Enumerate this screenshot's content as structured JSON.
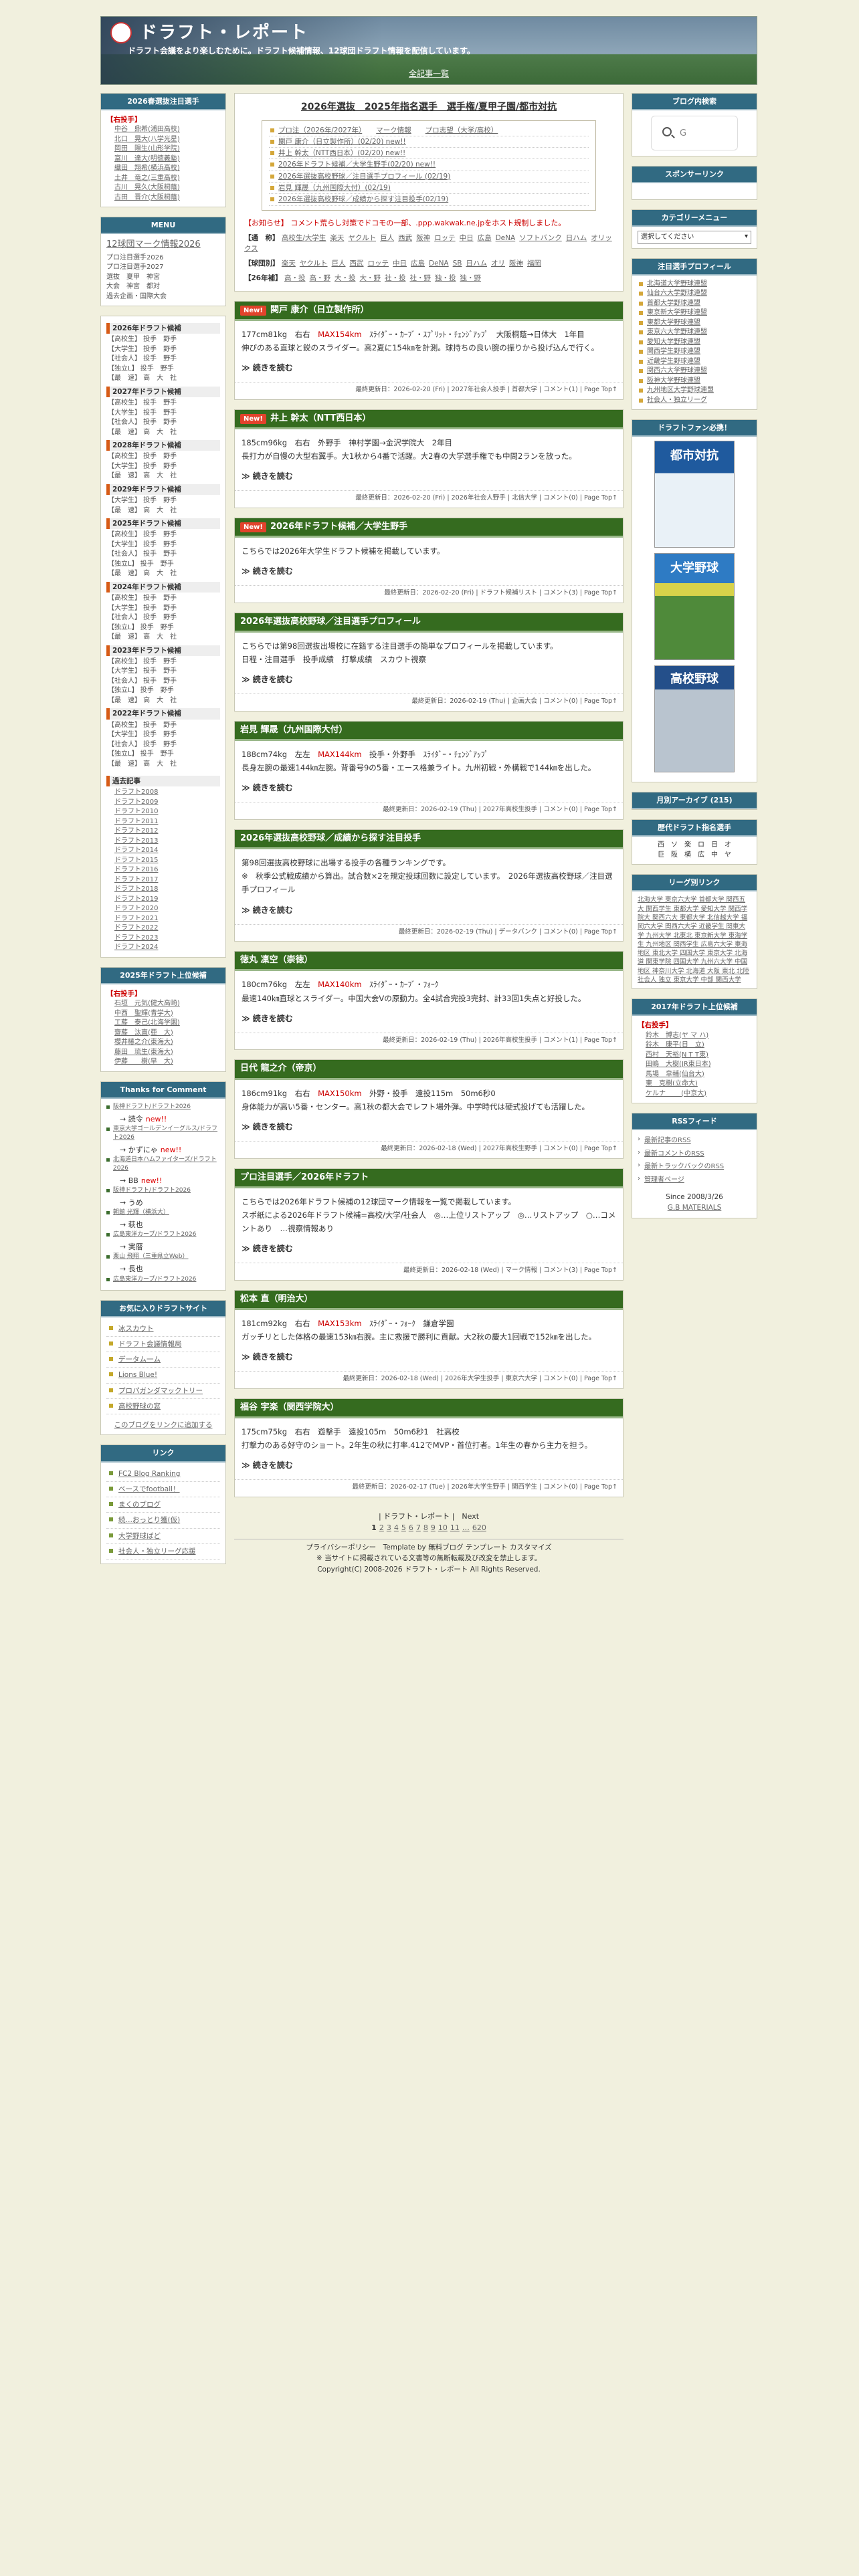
{
  "site": {
    "title": "ドラフト・レポート",
    "description": "ドラフト会議をより楽しむために。ドラフト候補情報、12球団ドラフト情報を配信しています。",
    "all_entries": "全記事一覧"
  },
  "left": {
    "watch": {
      "title": "2026春選抜注目選手",
      "heading": "【右投手】",
      "items": [
        "中谷　鼎希(浦田高校)",
        "北口　晃大(八学光星)",
        "岡田　陽生(山形学院)",
        "富川　達大(明徳義塾)",
        "織田　翔希(横浜高校)",
        "土井　竜之(三重高校)",
        "古川　晃久(大阪桐蔭)",
        "古田　晋介(大阪桐蔭)"
      ]
    },
    "menu": {
      "title": "MENU",
      "big": "12球団マーク情報2026",
      "subs": [
        "プロ注目選手2026",
        "プロ注目選手2027",
        "選抜　夏甲　神宮",
        "大会　神宮　都対",
        "過去企画・国際大会"
      ]
    },
    "cats": [
      {
        "title": "2026年ドラフト候補",
        "rows": [
          "【高校生】 投手　野手",
          "【大学生】 投手　野手",
          "【社会人】 投手　野手",
          "【独立L】 投手　野手",
          "【最　速】 高　大　社"
        ]
      },
      {
        "title": "2027年ドラフト候補",
        "rows": [
          "【高校生】 投手　野手",
          "【大学生】 投手　野手",
          "【社会人】 投手　野手",
          "【最　速】 高　大　社"
        ]
      },
      {
        "title": "2028年ドラフト候補",
        "rows": [
          "【高校生】 投手　野手",
          "【大学生】 投手　野手",
          "【最　速】 高　大　社"
        ]
      },
      {
        "title": "2029年ドラフト候補",
        "rows": [
          "【大学生】 投手　野手",
          "【最　速】 高　大　社"
        ]
      },
      {
        "title": "2025年ドラフト候補",
        "rows": [
          "【高校生】 投手　野手",
          "【大学生】 投手　野手",
          "【社会人】 投手　野手",
          "【独立L】 投手　野手",
          "【最　速】 高　大　社"
        ]
      },
      {
        "title": "2024年ドラフト候補",
        "rows": [
          "【高校生】 投手　野手",
          "【大学生】 投手　野手",
          "【社会人】 投手　野手",
          "【独立L】 投手　野手",
          "【最　速】 高　大　社"
        ]
      },
      {
        "title": "2023年ドラフト候補",
        "rows": [
          "【高校生】 投手　野手",
          "【大学生】 投手　野手",
          "【社会人】 投手　野手",
          "【独立L】 投手　野手",
          "【最　速】 高　大　社"
        ]
      },
      {
        "title": "2022年ドラフト候補",
        "rows": [
          "【高校生】 投手　野手",
          "【大学生】 投手　野手",
          "【社会人】 投手　野手",
          "【独立L】 投手　野手",
          "【最　速】 高　大　社"
        ]
      }
    ],
    "past": {
      "title": "過去記事",
      "years": [
        "ドラフト2008",
        "ドラフト2009",
        "ドラフト2010",
        "ドラフト2011",
        "ドラフト2012",
        "ドラフト2013",
        "ドラフト2014",
        "ドラフト2015",
        "ドラフト2016",
        "ドラフト2017",
        "ドラフト2018",
        "ドラフト2019",
        "ドラフト2020",
        "ドラフト2021",
        "ドラフト2022",
        "ドラフト2023",
        "ドラフト2024"
      ]
    },
    "top": {
      "title": "2025年ドラフト上位候補",
      "heading": "【右投手】",
      "items": [
        "石垣　元気(健大高崎)",
        "中西　聖輝(青学大)",
        "工藤　泰己(北海学園)",
        "齋藤　汰直(亜　大)",
        "櫻井椿之介(東海大)",
        "藤田　琉生(東海大)",
        "伊藤　　樹(早　大)"
      ]
    },
    "comments": {
      "title": "Thanks for Comment",
      "items": [
        {
          "t": "阪神ドラフト/ドラフト2026",
          "arrow": "→ 読令",
          "new": "new!!"
        },
        {
          "t": "東京大学ゴールデンイーグルス/ドラフト2026",
          "arrow": "→ かずにゃ",
          "new": "new!!"
        },
        {
          "t": "北海道日本ハムファイターズ/ドラフト2026",
          "arrow": "→ BB",
          "new": "new!!"
        },
        {
          "t": "阪神ドラフト/ドラフト2026",
          "arrow": "→ うめ",
          "new": ""
        },
        {
          "t": "朝館 光輝（横浜大）",
          "arrow": "→ 萩也",
          "new": ""
        },
        {
          "t": "広島東洋カープ/ドラフト2026",
          "arrow": "→ 実暦",
          "new": ""
        },
        {
          "t": "栗山 飛翔（三重県立Web）",
          "arrow": "→ 長也",
          "new": ""
        },
        {
          "t": "広島東洋カープ/ドラフト2026",
          "arrow": "",
          "new": ""
        }
      ]
    },
    "favs": {
      "title": "お気に入りドラフトサイト",
      "items": [
        "冰スカウト",
        "ドラフト会議情報局",
        "データム一ム",
        "Lions Blue!",
        "プロパガンダマックトリー",
        "高校野球の窓"
      ],
      "note": "このブログをリンクに追加する"
    },
    "links": {
      "title": "リンク",
      "items": [
        "FC2 Blog Ranking",
        "ベースでfootball！",
        "まくのブログ",
        "続…おっとり獲(仮)",
        "大学野球ばど",
        "社会人・独立リーグ応援"
      ]
    }
  },
  "main": {
    "title": "2026年選抜　2025年指名選手　選手権/夏甲子園/都市対抗",
    "nav": [
      {
        "a": "プロ注（2026年/2027年）",
        "b": "マーク情報",
        "c": "プロ志望（大学/高校）"
      },
      {
        "a": "関戸 康介（日立製作所）(02/20) new!!",
        "b": "",
        "c": ""
      },
      {
        "a": "井上 幹太（NTT西日本）(02/20) new!!",
        "b": "",
        "c": ""
      },
      {
        "a": "2026年ドラフト候補／大学生野手(02/20) new!!",
        "b": "",
        "c": ""
      },
      {
        "a": "2026年選抜高校野球／注目選手プロフィール (02/19)",
        "b": "",
        "c": ""
      },
      {
        "a": "岩見 輝晟（九州国際大付）(02/19)",
        "b": "",
        "c": ""
      },
      {
        "a": "2026年選抜高校野球／成績から探す注目投手(02/19)",
        "b": "",
        "c": ""
      }
    ],
    "notice": "【お知らせ】 コメント荒らし対策でドコモの一部、.ppp.wakwak.ne.jpをホスト規制しました。",
    "kw1_label": "【通　称】",
    "kw1": [
      "高校生/大学生",
      "楽天",
      "ヤクルト",
      "巨人",
      "西武",
      "阪神",
      "ロッテ",
      "中日",
      "広島",
      "DeNA",
      "ソフトバンク",
      "日ハム",
      "オリックス"
    ],
    "kw2_label": "【球団別】",
    "kw2": [
      "楽天",
      "ヤクルト",
      "巨人",
      "西武",
      "ロッテ",
      "中日",
      "広島",
      "DeNA",
      "SB",
      "日ハム",
      "オリ",
      "阪神",
      "福岡"
    ],
    "kw3_label": "【26年補】",
    "kw3": [
      "高・投",
      "高・野",
      "大・投",
      "大・野",
      "社・投",
      "社・野",
      "独・投",
      "独・野"
    ],
    "entries": [
      {
        "badge": "New!",
        "title": "関戸 康介（日立製作所）",
        "body1": "177cm81kg　右右　",
        "max": "MAX154km",
        "body2": "　ｽﾗｲﾀﾞｰ・ｶｰﾌﾞ・ｽﾌﾟﾘｯﾄ・ﾁｪﾝｼﾞｱｯﾌﾟ　大阪桐蔭→日体大　1年目",
        "body3": "伸びのある直球と鋭のスライダー。高2夏に154㎞を計測。球持ちの良い腕の振りから投げ込んで行く。",
        "more": "≫ 続きを読む",
        "foot": "最終更新日：2026-02-20 (Fri) | 2027年社会人投手 | 首都大学 | コメント(1) | Page Top↑"
      },
      {
        "badge": "New!",
        "title": "井上 幹太（NTT西日本）",
        "body1": "185cm96kg　右右　外野手　神村学園→金沢学院大　2年目",
        "max": "",
        "body2": "",
        "body3": "長打力が自慢の大型右翼手。大1秋から4番で活躍。大2春の大学選手権でも中問2ランを放った。",
        "more": "≫ 続きを読む",
        "foot": "最終更新日：2026-02-20 (Fri) | 2026年社会人野手 | 北信大学 | コメント(0) | Page Top↑"
      },
      {
        "badge": "New!",
        "title": "2026年ドラフト候補／大学生野手",
        "body1": "こちらでは2026年大学生ドラフト候補を掲載しています。",
        "max": "",
        "body2": "",
        "body3": "",
        "more": "≫ 続きを読む",
        "foot": "最終更新日：2026-02-20 (Fri) | ドラフト候補リスト | コメント(3) | Page Top↑"
      },
      {
        "badge": "",
        "title": "2026年選抜高校野球／注目選手プロフィール",
        "body1": "こちらでは第98回選抜出場校に在籍する注目選手の簡単なプロフィールを掲載しています。",
        "max": "",
        "body2": "",
        "body3": "日程・注目選手　投手成績　打撃成績　スカウト視察",
        "more": "≫ 続きを読む",
        "foot": "最終更新日：2026-02-19 (Thu) | 企画大会 | コメント(0) | Page Top↑"
      },
      {
        "badge": "",
        "title": "岩見 輝晟（九州国際大付）",
        "body1": "188cm74kg　左左　",
        "max": "MAX144km",
        "body2": "　投手・外野手　ｽﾗｲﾀﾞｰ・ﾁｪﾝｼﾞｱｯﾌﾟ",
        "body3": "長身左腕の最速144㎞左腕。背番号9の5番・エース格兼ライト。九州初戦・外構戦で144㎞を出した。",
        "more": "≫ 続きを読む",
        "foot": "最終更新日：2026-02-19 (Thu) | 2027年高校生投手 | コメント(0) | Page Top↑"
      },
      {
        "badge": "",
        "title": "2026年選抜高校野球／成績から探す注目投手",
        "body1": "第98回選抜高校野球に出場する投手の各種ランキングです。",
        "max": "",
        "body2": "",
        "body3": "※　秋季公式戦成績から算出。試合数×2を規定投球回数に設定しています。　2026年選抜高校野球／注目選手プロフィール",
        "more": "≫ 続きを読む",
        "foot": "最終更新日：2026-02-19 (Thu) | データバンク | コメント(0) | Page Top↑"
      },
      {
        "badge": "",
        "title": "徳丸 凜空（崇徳）",
        "body1": "180cm76kg　左左　",
        "max": "MAX140km",
        "body2": "　ｽﾗｲﾀﾞｰ・ｶｰﾌﾞ・ﾌｫｰｸ",
        "body3": "最速140㎞直球とスライダー。中国大会Vの原動力。全4試合完投3完封、計33回1失点と好投した。",
        "more": "≫ 続きを読む",
        "foot": "最終更新日：2026-02-19 (Thu) | 2026年高校生投手 | コメント(1) | Page Top↑"
      },
      {
        "badge": "",
        "title": "日代 龍之介（帝京）",
        "body1": "186cm91kg　右右　",
        "max": "MAX150km",
        "body2": "　外野・投手　遠投115m　50m6秒0",
        "body3": "身体能力が高い5番・センター。高1秋の都大会でレフト場外弾。中学時代は硬式投げても活躍した。",
        "more": "≫ 続きを読む",
        "foot": "最終更新日：2026-02-18 (Wed) | 2027年高校生野手 | コメント(0) | Page Top↑"
      },
      {
        "badge": "",
        "title": "プロ注目選手／2026年ドラフト",
        "body1": "こちらでは2026年ドラフト候補の12球団マーク情報を一覧で掲載しています。",
        "max": "",
        "body2": "",
        "body3": "スポ紙による2026年ドラフト候補=高校/大学/社会人　◎…上位リストアップ　◎…リストアップ　○…コメントあり　…視察情報あり",
        "more": "≫ 続きを読む",
        "foot": "最終更新日：2026-02-18 (Wed) | マーク情報 | コメント(3) | Page Top↑"
      },
      {
        "badge": "",
        "title": "松本 直（明治大）",
        "body1": "181cm92kg　右右　",
        "max": "MAX153km",
        "body2": "　ｽﾗｲﾀﾞｰ・ﾌｫｰｸ　鎌倉学園",
        "body3": "ガッチリとした体格の最速153㎞右腕。主に救援で勝利に貢献。大2秋の慶大1回戦で152㎞を出した。",
        "more": "≫ 続きを読む",
        "foot": "最終更新日：2026-02-18 (Wed) | 2026年大学生投手 | 東京六大学 | コメント(0) | Page Top↑"
      },
      {
        "badge": "",
        "title": "福谷 宇楽（関西学院大）",
        "body1": "175cm75kg　右右　遊撃手　遠投105m　50m6秒1　社高校",
        "max": "",
        "body2": "",
        "body3": "打撃力のある好守のショート。2年生の秋に打率.412でMVP・首位打者。1年生の春から主力を担う。",
        "more": "≫ 続きを読む",
        "foot": "最終更新日：2026-02-17 (Tue) | 2026年大学生野手 | 関西学生 | コメント(0) | Page Top↑"
      }
    ],
    "pager_top": "| ドラフト・レポート |　Next",
    "pages": [
      "1",
      "2",
      "3",
      "4",
      "5",
      "6",
      "7",
      "8",
      "9",
      "10",
      "11",
      "…",
      "620"
    ],
    "footer1": "プライバシーポリシー　Template by 無料ブログ テンプレート カスタマイズ",
    "footer2": "※ 当サイトに掲載されている文書等の無断転載及び改変を禁止します。",
    "footer3": "Copyright(C) 2008-2026 ドラフト・レポート All Rights Reserved."
  },
  "right": {
    "search": {
      "title": "ブログ内検索",
      "g": "G"
    },
    "sponsor": {
      "title": "スポンサーリンク"
    },
    "category": {
      "title": "カテゴリーメニュー",
      "select": "選択してください"
    },
    "profile": {
      "title": "注目選手プロフィール",
      "items": [
        "北海道大学野球連盟",
        "仙台六大学野球連盟",
        "首都大学野球連盟",
        "東京新大学野球連盟",
        "東都大学野球連盟",
        "東京六大学野球連盟",
        "愛知大学野球連盟",
        "関西学生野球連盟",
        "近畿学生野球連盟",
        "関西六大学野球連盟",
        "阪神大学野球連盟",
        "九州地区大学野球連盟",
        "社会人・独立リーグ"
      ]
    },
    "fan": {
      "title": "ドラフトファン必携！",
      "book1": "都市対抗",
      "book2": "大学野球",
      "book3": "高校野球"
    },
    "archive": {
      "title": "月別アーカイブ (215)"
    },
    "yearly": {
      "title": "歴代ドラフト指名選手",
      "rows": [
        "西　ソ　楽　ロ　日　オ",
        "巨　阪　横　広　中　ヤ"
      ]
    },
    "league": {
      "title": "リーグ別リンク",
      "text": "北海大学 東京六大学 首都大学 関西五大 関西学生 東都大学 愛知大学 関西学院大 関西六大 東都大学 北信越大学 福岡六大学 関西六大学 近畿学生 関東大学 九州大学 北東北 東京新大学 東海学生 九州地区 関西学生 広島六大学 東海地区 東北大学 四国大学 東京大学 北海道 関東学院 四国大学 九州六大学 中国地区 神奈川大学 北海道 大阪 東北 北陸 社会人 独立 東京大学 中部 関西大学"
    },
    "top2017": {
      "title": "2017年ドラフト上位候補",
      "heading": "【右投手】",
      "items": [
        "鈴木　博志(ヤ マ ハ)",
        "鈴木　康平(日　立)",
        "西村　天裕(N T T東)",
        "田嶋　大樹(JR東日本)",
        "馬場　皐輔(仙台大)",
        "東　克樹(立命大)",
        "ケルナ　 　(中京大)"
      ]
    },
    "rss": {
      "title": "RSSフィード",
      "items": [
        "最新記事のRSS",
        "最新コメントのRSS",
        "最新トラックバックのRSS",
        "管理者ページ"
      ],
      "since": "Since 2008/3/26",
      "gb": "G.B MATERIALS"
    }
  }
}
